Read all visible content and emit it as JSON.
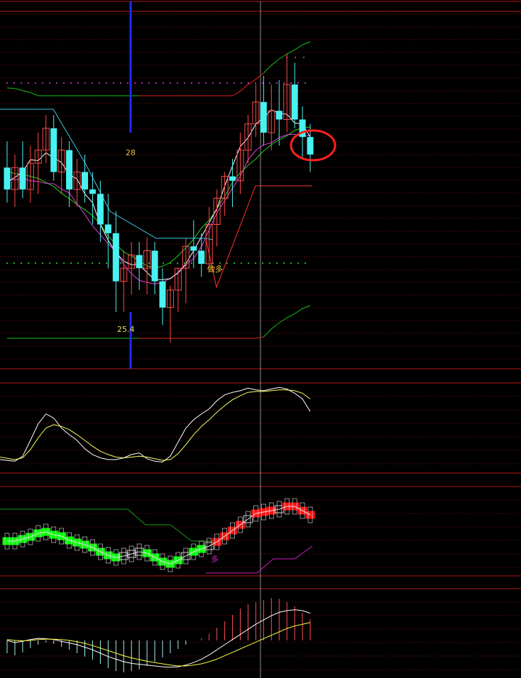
{
  "chart_data": [
    {
      "type": "candlestick",
      "panel": "main",
      "annotations": {
        "high_marker": "28",
        "low_marker": "25.4",
        "signal_label": "做多"
      },
      "colors": {
        "up": "#ff4a4a",
        "down": "#48f2f2",
        "ma_white": "#ffffff",
        "ma_magenta": "#e040e0",
        "ma_green": "#22d022",
        "band": "#10c010",
        "band_red": "#e02020",
        "stop_cyan": "#3cc8e8",
        "stop_red": "#ff3030",
        "highlight_circle": "#ff2020",
        "marker_line": "#1a2cff",
        "text_yellow": "#e8c040"
      },
      "candles": [
        {
          "o": 27.35,
          "h": 27.65,
          "l": 26.95,
          "c": 27.1
        },
        {
          "o": 27.1,
          "h": 27.5,
          "l": 26.9,
          "c": 27.35
        },
        {
          "o": 27.35,
          "h": 27.65,
          "l": 27.0,
          "c": 27.1
        },
        {
          "o": 27.1,
          "h": 27.6,
          "l": 26.95,
          "c": 27.4
        },
        {
          "o": 27.4,
          "h": 27.75,
          "l": 27.05,
          "c": 27.55
        },
        {
          "o": 27.55,
          "h": 27.95,
          "l": 27.4,
          "c": 27.8
        },
        {
          "o": 27.8,
          "h": 27.95,
          "l": 27.2,
          "c": 27.3
        },
        {
          "o": 27.3,
          "h": 27.7,
          "l": 27.05,
          "c": 27.55
        },
        {
          "o": 27.55,
          "h": 27.65,
          "l": 26.9,
          "c": 27.1
        },
        {
          "o": 27.1,
          "h": 27.45,
          "l": 26.9,
          "c": 27.3
        },
        {
          "o": 27.3,
          "h": 27.5,
          "l": 26.95,
          "c": 27.1
        },
        {
          "o": 27.1,
          "h": 27.3,
          "l": 26.7,
          "c": 27.05
        },
        {
          "o": 27.05,
          "h": 27.2,
          "l": 26.5,
          "c": 26.7
        },
        {
          "o": 26.7,
          "h": 27.05,
          "l": 26.2,
          "c": 26.6
        },
        {
          "o": 26.6,
          "h": 26.85,
          "l": 25.7,
          "c": 26.05
        },
        {
          "o": 26.05,
          "h": 26.4,
          "l": 25.7,
          "c": 26.2
        },
        {
          "o": 26.2,
          "h": 26.5,
          "l": 25.9,
          "c": 26.35
        },
        {
          "o": 26.35,
          "h": 26.5,
          "l": 25.95,
          "c": 26.2
        },
        {
          "o": 26.2,
          "h": 26.55,
          "l": 25.9,
          "c": 26.4
        },
        {
          "o": 26.4,
          "h": 26.5,
          "l": 25.9,
          "c": 26.05
        },
        {
          "o": 26.05,
          "h": 26.2,
          "l": 25.55,
          "c": 25.75
        },
        {
          "o": 25.75,
          "h": 26.0,
          "l": 25.35,
          "c": 25.95
        },
        {
          "o": 25.95,
          "h": 26.2,
          "l": 25.7,
          "c": 26.2
        },
        {
          "o": 26.2,
          "h": 26.55,
          "l": 25.8,
          "c": 26.45
        },
        {
          "o": 26.45,
          "h": 26.75,
          "l": 26.2,
          "c": 26.4
        },
        {
          "o": 26.4,
          "h": 26.6,
          "l": 26.1,
          "c": 26.25
        },
        {
          "o": 26.25,
          "h": 26.9,
          "l": 26.2,
          "c": 26.7
        },
        {
          "o": 26.7,
          "h": 27.1,
          "l": 26.45,
          "c": 27.0
        },
        {
          "o": 27.0,
          "h": 27.3,
          "l": 26.8,
          "c": 27.25
        },
        {
          "o": 27.25,
          "h": 27.45,
          "l": 26.9,
          "c": 27.2
        },
        {
          "o": 27.2,
          "h": 27.75,
          "l": 27.05,
          "c": 27.55
        },
        {
          "o": 27.55,
          "h": 27.95,
          "l": 27.4,
          "c": 27.85
        },
        {
          "o": 27.85,
          "h": 28.3,
          "l": 27.7,
          "c": 28.1
        },
        {
          "o": 28.1,
          "h": 28.4,
          "l": 27.6,
          "c": 27.75
        },
        {
          "o": 27.75,
          "h": 28.3,
          "l": 27.55,
          "c": 28.0
        },
        {
          "o": 28.0,
          "h": 28.35,
          "l": 27.6,
          "c": 27.9
        },
        {
          "o": 27.9,
          "h": 28.65,
          "l": 27.75,
          "c": 28.3
        },
        {
          "o": 28.3,
          "h": 28.55,
          "l": 27.8,
          "c": 27.9
        },
        {
          "o": 27.9,
          "h": 28.05,
          "l": 27.45,
          "c": 27.7
        },
        {
          "o": 27.7,
          "h": 27.85,
          "l": 27.3,
          "c": 27.5
        }
      ]
    },
    {
      "type": "line",
      "panel": "oscillator_1",
      "series": [
        {
          "color": "#ffffff",
          "values": [
            0.12,
            0.1,
            0.16,
            0.35,
            0.55,
            0.67,
            0.62,
            0.5,
            0.42,
            0.35,
            0.25,
            0.18,
            0.14,
            0.12,
            0.12,
            0.14,
            0.18,
            0.2,
            0.13,
            0.1,
            0.09,
            0.16,
            0.33,
            0.5,
            0.6,
            0.67,
            0.73,
            0.83,
            0.9,
            0.93,
            0.95,
            0.98,
            0.96,
            0.95,
            0.97,
            0.99,
            0.97,
            0.92,
            0.85,
            0.7
          ]
        },
        {
          "color": "#ffff66",
          "values": [
            0.15,
            0.12,
            0.14,
            0.24,
            0.38,
            0.5,
            0.54,
            0.52,
            0.48,
            0.42,
            0.35,
            0.28,
            0.22,
            0.18,
            0.15,
            0.14,
            0.15,
            0.16,
            0.15,
            0.13,
            0.11,
            0.12,
            0.19,
            0.3,
            0.42,
            0.52,
            0.6,
            0.69,
            0.77,
            0.84,
            0.89,
            0.93,
            0.94,
            0.94,
            0.95,
            0.96,
            0.96,
            0.95,
            0.92,
            0.85
          ]
        }
      ]
    },
    {
      "type": "bar",
      "panel": "oscillator_2",
      "signal_label": "多",
      "boxes": [
        {
          "v": 0.37,
          "state": "green"
        },
        {
          "v": 0.37,
          "state": "green"
        },
        {
          "v": 0.4,
          "state": "green"
        },
        {
          "v": 0.43,
          "state": "green"
        },
        {
          "v": 0.48,
          "state": "green"
        },
        {
          "v": 0.5,
          "state": "green"
        },
        {
          "v": 0.46,
          "state": "green"
        },
        {
          "v": 0.44,
          "state": "green"
        },
        {
          "v": 0.38,
          "state": "green"
        },
        {
          "v": 0.35,
          "state": "green"
        },
        {
          "v": 0.32,
          "state": "green"
        },
        {
          "v": 0.28,
          "state": "green"
        },
        {
          "v": 0.22,
          "state": "green"
        },
        {
          "v": 0.17,
          "state": "green"
        },
        {
          "v": 0.14,
          "state": "green"
        },
        {
          "v": 0.16,
          "state": "white"
        },
        {
          "v": 0.19,
          "state": "white"
        },
        {
          "v": 0.22,
          "state": "white"
        },
        {
          "v": 0.2,
          "state": "green"
        },
        {
          "v": 0.14,
          "state": "green"
        },
        {
          "v": 0.08,
          "state": "green"
        },
        {
          "v": 0.05,
          "state": "green"
        },
        {
          "v": 0.1,
          "state": "green"
        },
        {
          "v": 0.16,
          "state": "white"
        },
        {
          "v": 0.22,
          "state": "green"
        },
        {
          "v": 0.26,
          "state": "green"
        },
        {
          "v": 0.3,
          "state": "white"
        },
        {
          "v": 0.36,
          "state": "red"
        },
        {
          "v": 0.44,
          "state": "red"
        },
        {
          "v": 0.52,
          "state": "red"
        },
        {
          "v": 0.6,
          "state": "red"
        },
        {
          "v": 0.68,
          "state": "white"
        },
        {
          "v": 0.76,
          "state": "red"
        },
        {
          "v": 0.78,
          "state": "red"
        },
        {
          "v": 0.8,
          "state": "red"
        },
        {
          "v": 0.82,
          "state": "white"
        },
        {
          "v": 0.86,
          "state": "red"
        },
        {
          "v": 0.86,
          "state": "red"
        },
        {
          "v": 0.8,
          "state": "red"
        },
        {
          "v": 0.74,
          "state": "red"
        }
      ]
    },
    {
      "type": "bar",
      "panel": "macd",
      "series": [
        {
          "name": "hist",
          "values": [
            -0.3,
            -0.35,
            -0.28,
            -0.18,
            -0.1,
            -0.05,
            -0.08,
            -0.15,
            -0.22,
            -0.3,
            -0.38,
            -0.45,
            -0.55,
            -0.65,
            -0.72,
            -0.75,
            -0.72,
            -0.68,
            -0.6,
            -0.5,
            -0.4,
            -0.3,
            -0.2,
            -0.1,
            0.0,
            0.05,
            0.15,
            0.3,
            0.45,
            0.6,
            0.75,
            0.85,
            0.9,
            0.95,
            1.0,
            0.98,
            0.9,
            0.8,
            0.65,
            0.5
          ]
        },
        {
          "name": "dif",
          "values": [
            0.0,
            -0.05,
            -0.02,
            0.02,
            0.05,
            0.04,
            0.02,
            -0.02,
            -0.06,
            -0.1,
            -0.16,
            -0.22,
            -0.3,
            -0.38,
            -0.44,
            -0.5,
            -0.54,
            -0.56,
            -0.58,
            -0.6,
            -0.62,
            -0.63,
            -0.62,
            -0.58,
            -0.52,
            -0.44,
            -0.34,
            -0.22,
            -0.1,
            0.02,
            0.14,
            0.26,
            0.38,
            0.48,
            0.58,
            0.66,
            0.7,
            0.72,
            0.7,
            0.64
          ]
        },
        {
          "name": "dea",
          "values": [
            0.02,
            0.0,
            -0.01,
            0.0,
            0.02,
            0.03,
            0.03,
            0.02,
            0.0,
            -0.03,
            -0.07,
            -0.12,
            -0.18,
            -0.24,
            -0.3,
            -0.36,
            -0.41,
            -0.45,
            -0.49,
            -0.52,
            -0.55,
            -0.58,
            -0.6,
            -0.6,
            -0.58,
            -0.55,
            -0.5,
            -0.44,
            -0.36,
            -0.28,
            -0.2,
            -0.12,
            -0.04,
            0.04,
            0.12,
            0.2,
            0.28,
            0.34,
            0.38,
            0.42
          ]
        }
      ]
    }
  ]
}
